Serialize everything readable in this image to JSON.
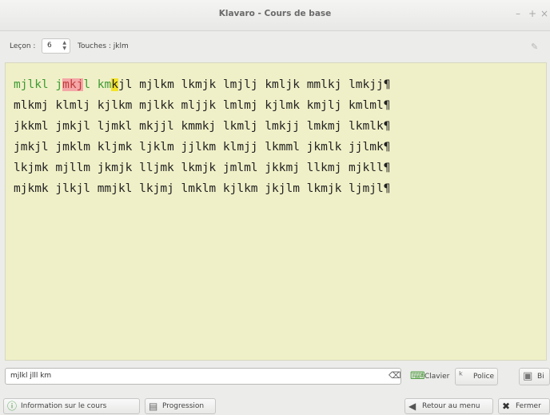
{
  "window": {
    "title": "Klavaro - Cours de base",
    "minimize": "–",
    "maximize": "+",
    "close": "×"
  },
  "toolbar": {
    "lesson_label": "Leçon :",
    "lesson_value": "6",
    "keys_label": "Touches : jklm",
    "settings_icon": "settings-icon"
  },
  "exercise": {
    "lines": [
      [
        {
          "text": "mjlkl ",
          "state": "typed"
        },
        {
          "text": "j",
          "state": "typed"
        },
        {
          "text": "mkj",
          "state": "error"
        },
        {
          "text": "l ",
          "state": "typed"
        },
        {
          "text": "km",
          "state": "typed"
        },
        {
          "text": "k",
          "state": "cursor"
        },
        {
          "text": "jl mjlkm lkmjk lmjlj kmljk mmlkj lmkjj¶",
          "state": "pending"
        }
      ],
      [
        {
          "text": "mlkmj klmlj kjlkm mjlkk mljjk lmlmj kjlmk kmjlj kmlml¶",
          "state": "pending"
        }
      ],
      [
        {
          "text": "jkkml jmkjl ljmkl mkjjl kmmkj lkmlj lmkjj lmkmj lkmlk¶",
          "state": "pending"
        }
      ],
      [
        {
          "text": "jmkjl jmklm kljmk ljklm jjlkm klmjj lkmml jkmlk jjlmk¶",
          "state": "pending"
        }
      ],
      [
        {
          "text": "lkjmk mjllm jkmjk lljmk lkmjk jmlml jkkmj llkmj mjkll¶",
          "state": "pending"
        }
      ],
      [
        {
          "text": "mjkmk jlkjl mmjkl lkjmj lmklm kjlkm jkjlm lkmjk ljmjl¶",
          "state": "pending"
        }
      ]
    ],
    "colors": {
      "background": "#f0f0c8",
      "typed": "#3e9a34",
      "error_bg": "#f4a7a7",
      "cursor_bg": "#f3e32a"
    }
  },
  "input": {
    "value": "mjlkl jlll km",
    "clear_icon": "clear-icon"
  },
  "buttons": {
    "keyboard": "Clavier",
    "font": "Police",
    "color": "Bi",
    "course_info": "Information sur le cours",
    "progress": "Progression",
    "back_to_menu": "Retour au menu",
    "close": "Fermer"
  }
}
